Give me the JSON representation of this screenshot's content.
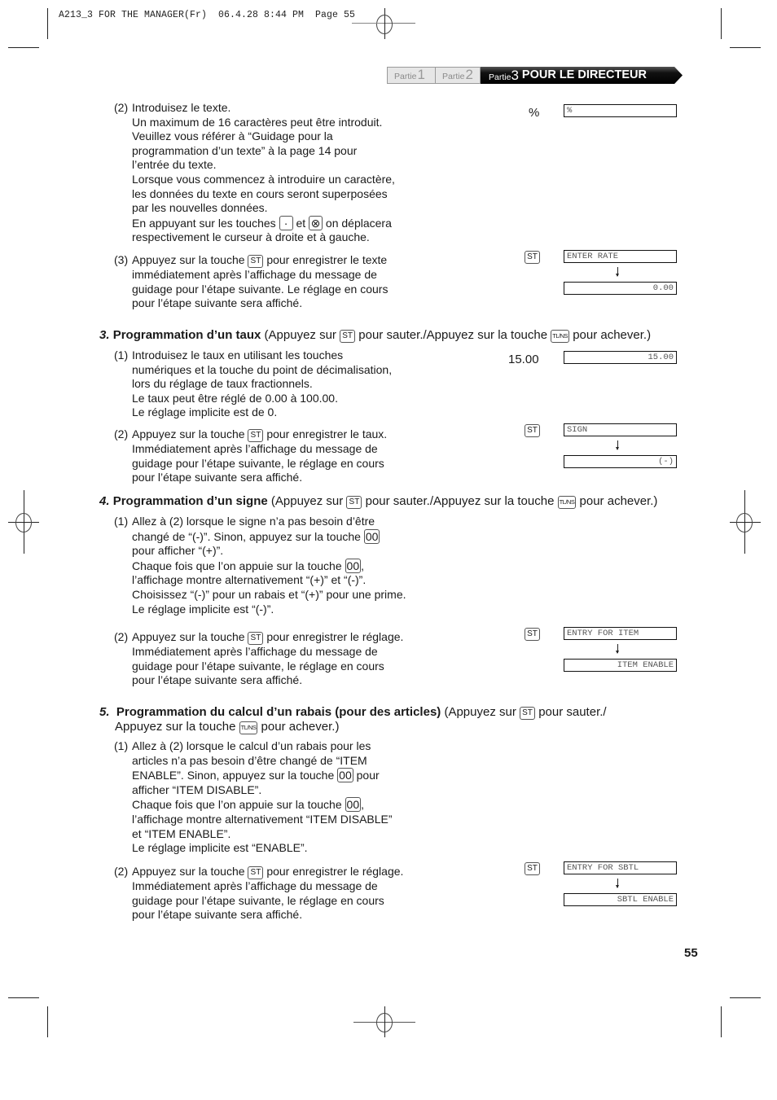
{
  "slug": "A213_3 FOR THE MANAGER(Fr)  06.4.28 8:44 PM  Page 55",
  "header": {
    "tab1": {
      "label": "Partie",
      "num": "1"
    },
    "tab2": {
      "label": "Partie",
      "num": "2"
    },
    "tab3": {
      "label": "Partie",
      "num": "3",
      "title": "POUR LE DIRECTEUR"
    }
  },
  "keys": {
    "st": "ST",
    "tlns": "TL/NS",
    "dot": "·",
    "void": "⊗",
    "double_zero": "00"
  },
  "step2_text": {
    "num": "(2)",
    "lines": [
      "Introduisez le texte.",
      "Un maximum de 16 caractères peut être introduit.",
      "Veuillez vous référer à “Guidage pour la",
      "programmation d’un texte” à la page 14 pour",
      "l’entrée du texte.",
      "Lorsque vous commencez à introduire un caractère,",
      "les données du texte en cours seront superposées",
      "par les nouvelles données."
    ],
    "keys_line_a": "En appuyant sur les touches",
    "keys_line_b": "et",
    "keys_line_c": "on déplacera",
    "last_line": "respectivement le curseur à droite et à gauche."
  },
  "step3_text": {
    "num": "(3)",
    "first_a": "Appuyez sur la touche",
    "first_b": "pour enregistrer le texte",
    "lines": [
      "immédiatement après l’affichage du message de",
      "guidage pour l’étape suivante. Le réglage en cours",
      "pour l’étape suivante sera affiché."
    ]
  },
  "section3": {
    "number": "3.",
    "title": "Programmation d’un taux",
    "skip_a": "(Appuyez sur",
    "skip_b": "pour sauter./Appuyez sur la touche",
    "skip_c": "pour achever.)",
    "item1": {
      "num": "(1)",
      "lines": [
        "Introduisez le taux en utilisant les touches",
        "numériques et la touche du point de décimalisation,",
        "lors du réglage de taux fractionnels.",
        "Le taux peut être réglé de 0.00 à 100.00.",
        "Le réglage implicite est de 0."
      ]
    },
    "item2": {
      "num": "(2)",
      "first_a": "Appuyez sur la touche",
      "first_b": "pour enregistrer le taux.",
      "lines": [
        "Immédiatement après l’affichage du message de",
        "guidage pour l’étape suivante, le réglage en cours",
        "pour l’étape suivante sera affiché."
      ]
    }
  },
  "section4": {
    "number": "4.",
    "title": "Programmation d’un signe",
    "skip_a": "(Appuyez sur",
    "skip_b": "pour sauter./Appuyez sur la touche",
    "skip_c": "pour achever.)",
    "item1": {
      "num": "(1)",
      "line1": "Allez à (2) lorsque le signe n’a pas besoin d’être",
      "line2": "changé de “(-)”. Sinon, appuyez sur la touche",
      "line3": "pour afficher “(+)”.",
      "line4": "Chaque fois que l’on appuie sur la touche",
      "line4_end": ",",
      "lines": [
        "l’affichage montre alternativement “(+)” et “(-)”.",
        "Choisissez “(-)” pour un rabais et “(+)” pour une prime.",
        "Le réglage implicite est “(-)”."
      ]
    },
    "item2": {
      "num": "(2)",
      "first_a": "Appuyez sur la touche",
      "first_b": "pour enregistrer le réglage.",
      "lines": [
        "Immédiatement après l’affichage du message de",
        "guidage pour l’étape suivante, le réglage en cours",
        "pour l’étape suivante sera affiché."
      ]
    }
  },
  "section5": {
    "number": "5.",
    "title": "Programmation du calcul d’un rabais (pour des articles)",
    "skip_a": "(Appuyez sur",
    "skip_b": "pour sauter./",
    "skip_line2_a": "Appuyez sur la touche",
    "skip_c": "pour achever.)",
    "item1": {
      "num": "(1)",
      "line1": "Allez à (2) lorsque le calcul d’un rabais pour les",
      "line2": "articles n’a pas besoin d’être changé de “ITEM",
      "line3_a": "ENABLE”. Sinon, appuyez sur la touche",
      "line3_b": "pour",
      "line4": "afficher “ITEM DISABLE”.",
      "line5": "Chaque fois que l’on appuie sur la touche",
      "line5_end": ",",
      "lines": [
        "l’affichage montre alternativement “ITEM DISABLE”",
        "et “ITEM ENABLE”.",
        "Le réglage implicite est “ENABLE”."
      ]
    },
    "item2": {
      "num": "(2)",
      "first_a": "Appuyez sur la touche",
      "first_b": "pour enregistrer le réglage.",
      "lines": [
        "Immédiatement après l’affichage du message de",
        "guidage pour l’étape suivante, le réglage en cours",
        "pour l’étape suivante sera affiché."
      ]
    }
  },
  "right": {
    "text_input": "%",
    "text_display": "%",
    "enter_rate_display": "ENTER RATE",
    "rate_default_display": "0.00",
    "rate_input": "15.00",
    "rate_display": "15.00",
    "sign_display": "SIGN",
    "sign_default_display": "(-)",
    "entry_item_display": "ENTRY FOR ITEM",
    "item_enable_display": "ITEM ENABLE",
    "entry_sbtl_display": "ENTRY FOR SBTL",
    "sbtl_enable_display": "SBTL ENABLE"
  },
  "page_number": "55"
}
